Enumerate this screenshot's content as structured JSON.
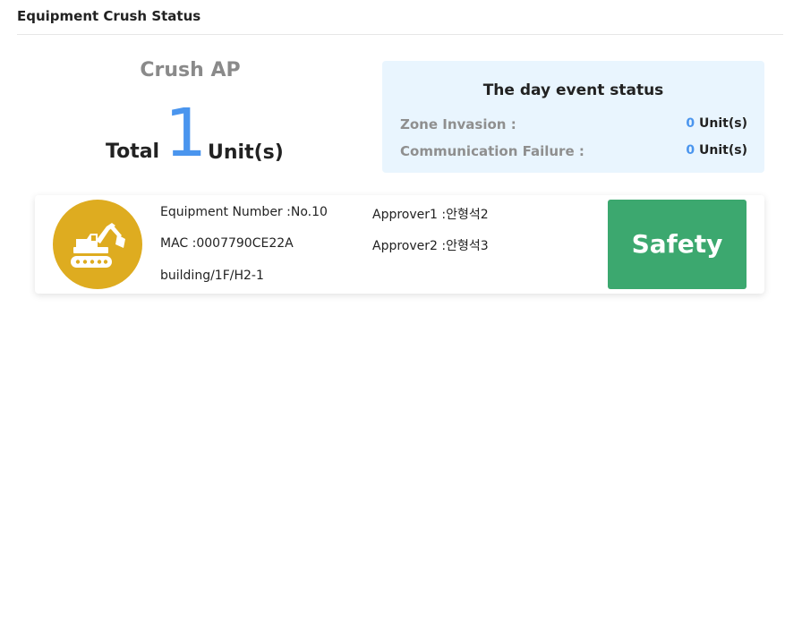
{
  "header": {
    "title": "Equipment Crush Status"
  },
  "summary": {
    "title": "Crush AP",
    "total_label": "Total",
    "total_count": "1",
    "total_unit": "Unit(s)"
  },
  "day_event": {
    "title": "The day event status",
    "rows": [
      {
        "label": "Zone Invasion :",
        "count": "0",
        "unit": "Unit(s)"
      },
      {
        "label": "Communication Failure :",
        "count": "0",
        "unit": "Unit(s)"
      }
    ]
  },
  "equipment": {
    "icon": "excavator-icon",
    "number": "Equipment Number :No.10",
    "mac": "MAC :0007790CE22A",
    "location": "building/1F/H2-1",
    "approver1": "Approver1 :안형석2",
    "approver2": "Approver2 :안형석3",
    "status_label": "Safety",
    "status_color": "#3ca86f",
    "icon_bg_color": "#deac20"
  },
  "colors": {
    "accent": "#4a95ee",
    "event_bg": "#e9f5fe"
  }
}
